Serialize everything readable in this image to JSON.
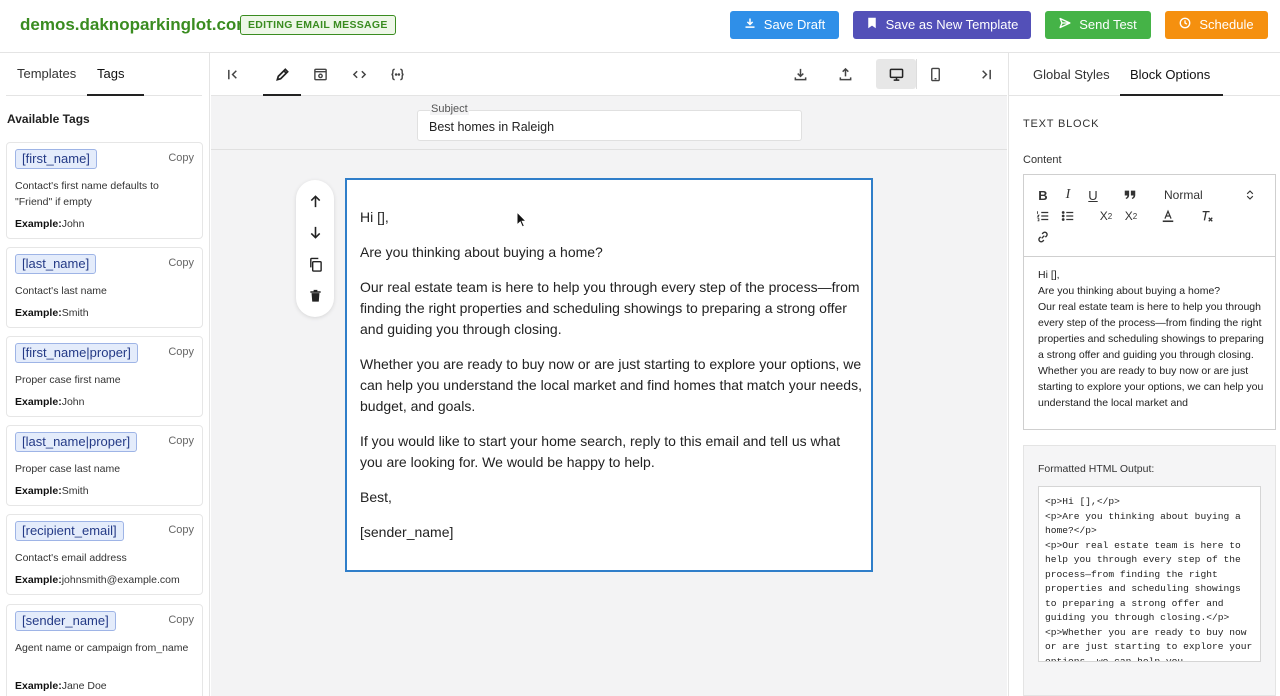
{
  "header": {
    "domain": "demos.daknoparkinglot.com",
    "badge": "EDITING EMAIL MESSAGE",
    "buttons": {
      "save_draft": "Save Draft",
      "save_template": "Save as New Template",
      "send_test": "Send Test",
      "schedule": "Schedule"
    }
  },
  "left": {
    "tabs": [
      "Templates",
      "Tags"
    ],
    "active_tab": "Tags",
    "available_label": "Available Tags",
    "tags": [
      {
        "tag": "[first_name]",
        "copy": "Copy",
        "desc": "Contact's first name defaults to \"Friend\" if empty",
        "example_label": "Example:",
        "example": "John"
      },
      {
        "tag": "[last_name]",
        "copy": "Copy",
        "desc": "Contact's last name",
        "example_label": "Example:",
        "example": "Smith"
      },
      {
        "tag": "[first_name|proper]",
        "copy": "Copy",
        "desc": "Proper case first name",
        "example_label": "Example:",
        "example": "John"
      },
      {
        "tag": "[last_name|proper]",
        "copy": "Copy",
        "desc": "Proper case last name",
        "example_label": "Example:",
        "example": "Smith"
      },
      {
        "tag": "[recipient_email]",
        "copy": "Copy",
        "desc": "Contact's email address",
        "example_label": "Example:",
        "example": "johnsmith@example.com"
      },
      {
        "tag": "[sender_name]",
        "copy": "Copy",
        "desc": "Agent name or campaign from_name",
        "example_label": "Example:",
        "example": "Jane Doe"
      }
    ]
  },
  "center": {
    "subject_label": "Subject",
    "subject_value": "Best homes in Raleigh",
    "email_paragraphs": [
      "Hi [],",
      "Are you thinking about buying a home?",
      "Our real estate team is here to help you through every step of the process—from finding the right properties and scheduling showings to preparing a strong offer and guiding you through closing.",
      "Whether you are ready to buy now or are just starting to explore your options, we can help you understand the local market and find homes that match your needs, budget, and goals.",
      "If you would like to start your home search, reply to this email and tell us what you are looking for. We would be happy to help.",
      "Best,",
      "[sender_name]"
    ]
  },
  "right": {
    "tabs": [
      "Global Styles",
      "Block Options"
    ],
    "active_tab": "Block Options",
    "section_title": "TEXT BLOCK",
    "content_label": "Content",
    "format_select": "Normal",
    "editor_text": "Hi [],\nAre you thinking about buying a home?\nOur real estate team is here to help you through every step of the process—from finding the right properties and scheduling showings to preparing a strong offer and guiding you through closing.\nWhether you are ready to buy now or are just starting to explore your options, we can help you understand the local market and",
    "output_label": "Formatted HTML Output:",
    "output_code": "<p>Hi [],</p>\n<p>Are you thinking about buying a home?</p>\n<p>Our real estate team is here to help you through every step of the process—from finding the right properties and scheduling showings to preparing a strong offer and guiding you through closing.</p>\n<p>Whether you are ready to buy now or are just starting to explore your options, we can help you"
  },
  "colors": {
    "domain_green": "#3a8c20",
    "save_draft": "#2f8fe8",
    "save_template": "#5350b8",
    "send_test": "#45b347",
    "schedule": "#f5900f",
    "block_border": "#2f7ec9",
    "tag_chip_bg": "#e4ecfb"
  },
  "icons": {
    "toolbar": [
      "collapse-left-icon",
      "pencil-icon",
      "preview-icon",
      "code-icon",
      "braces-icon",
      "download-icon",
      "upload-icon",
      "desktop-icon",
      "mobile-icon",
      "collapse-right-icon"
    ],
    "block_actions": [
      "arrow-up-icon",
      "arrow-down-icon",
      "duplicate-icon",
      "trash-icon"
    ]
  }
}
